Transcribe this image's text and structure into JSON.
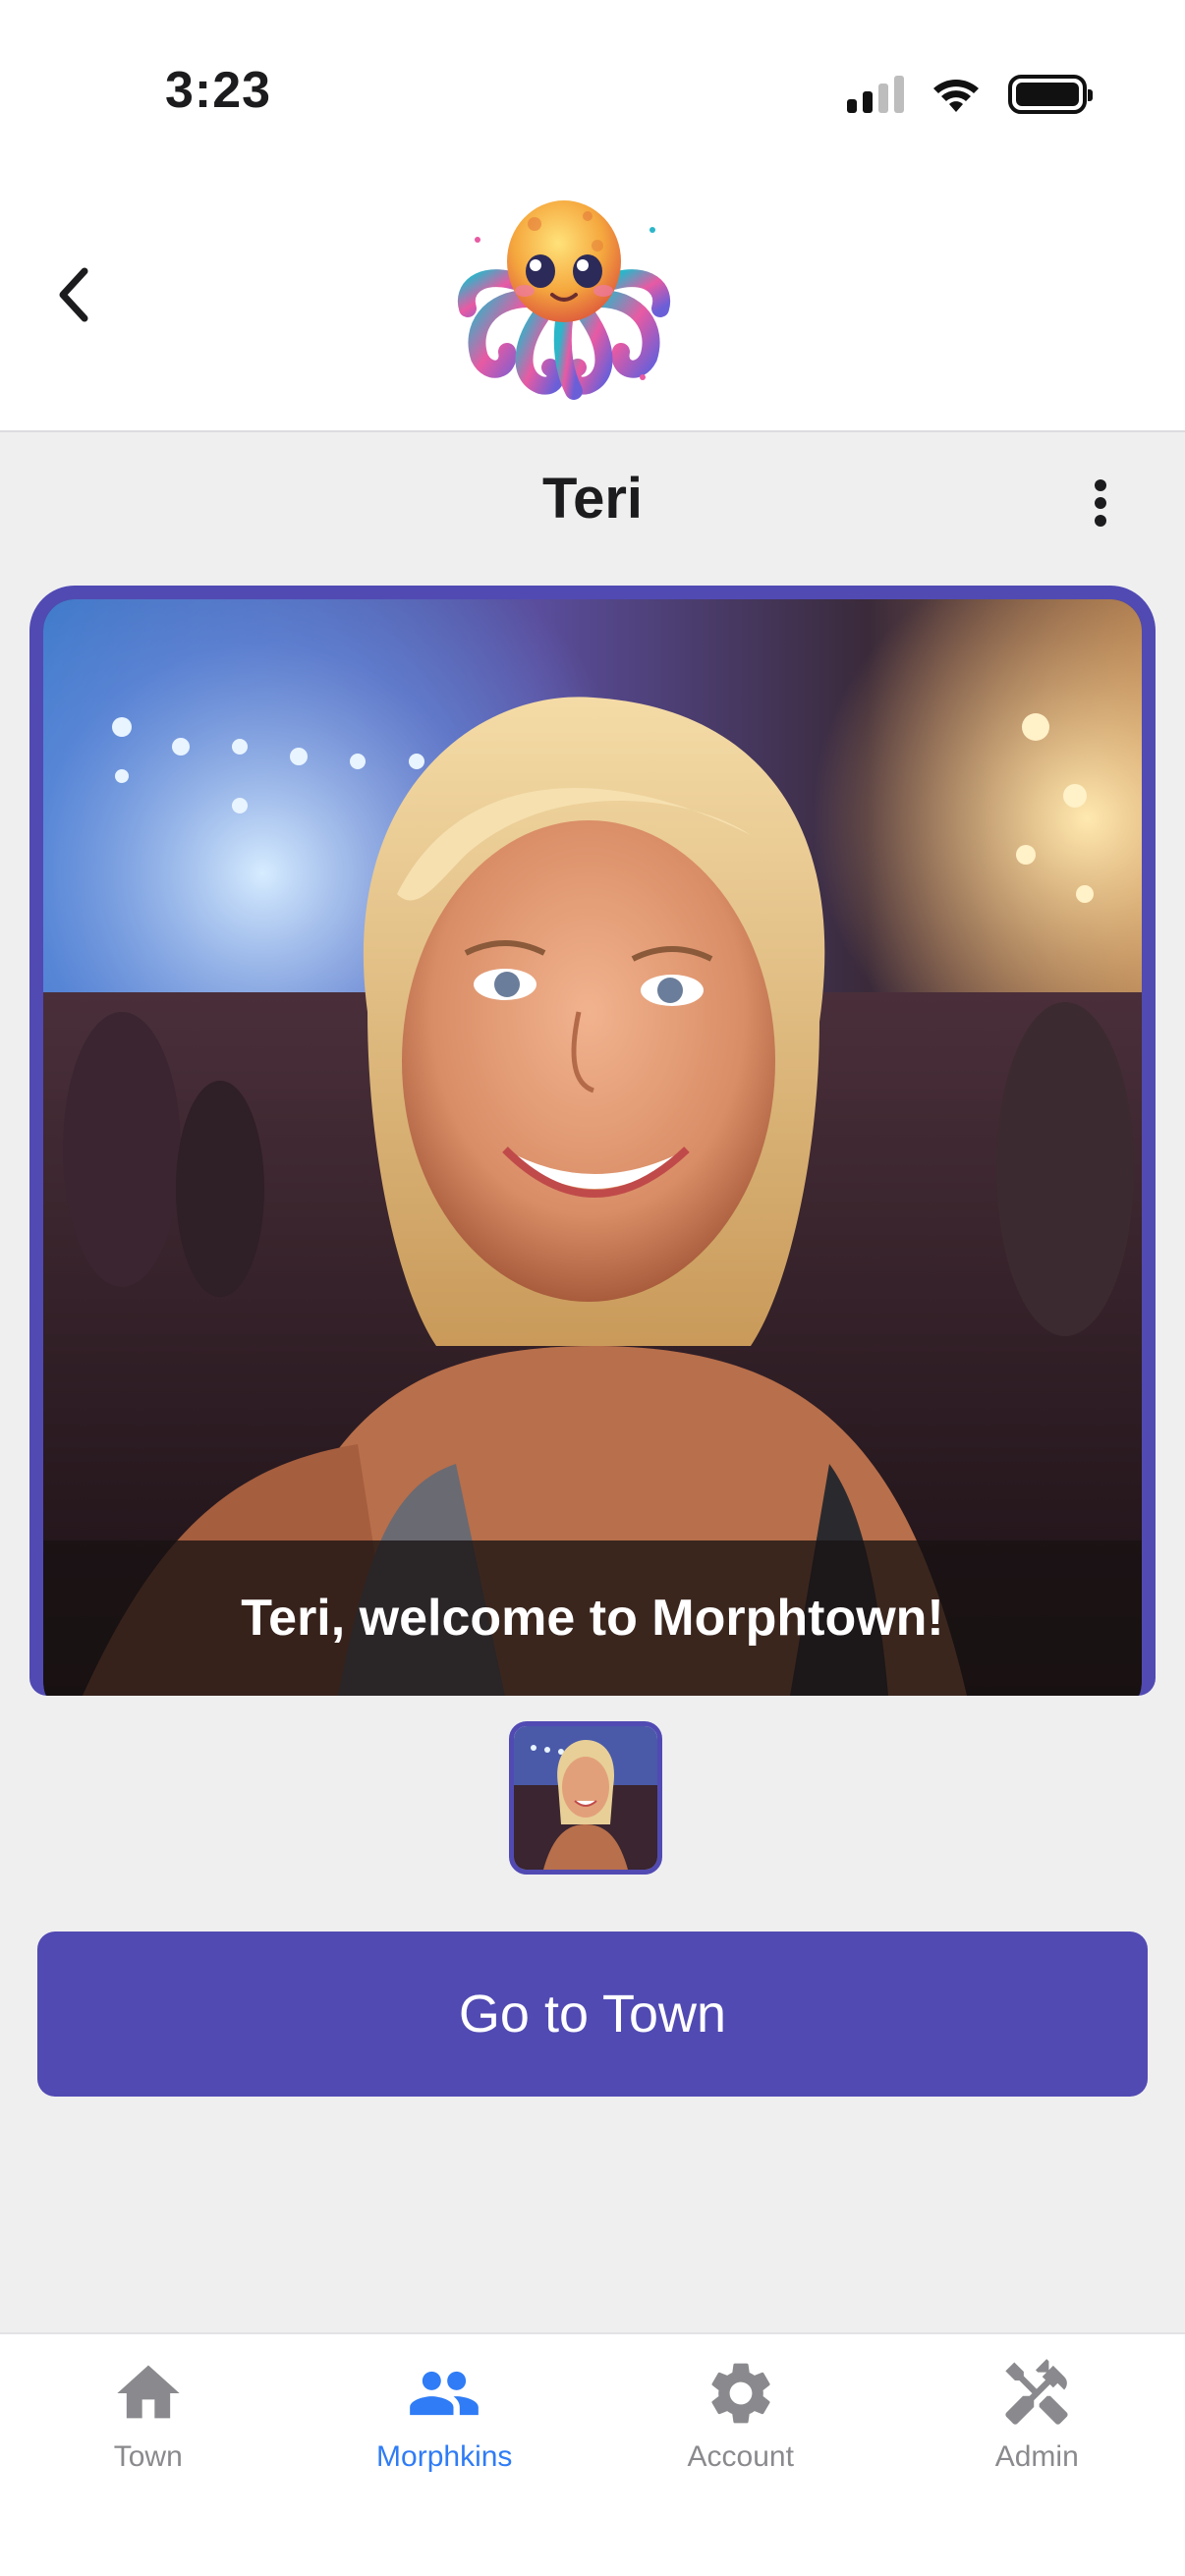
{
  "status_bar": {
    "time": "3:23"
  },
  "header": {
    "back_icon": "chevron-left-icon",
    "logo_icon": "octopus-mascot-icon"
  },
  "page": {
    "title": "Teri",
    "menu_icon": "vertical-dots-icon"
  },
  "photo": {
    "caption": "Teri, welcome to Morphtown!"
  },
  "cta": {
    "label": "Go to Town"
  },
  "tabs": [
    {
      "label": "Town",
      "icon": "home-icon",
      "active": false
    },
    {
      "label": "Morphkins",
      "icon": "people-icon",
      "active": true
    },
    {
      "label": "Account",
      "icon": "gear-icon",
      "active": false
    },
    {
      "label": "Admin",
      "icon": "tools-icon",
      "active": false
    }
  ],
  "colors": {
    "accent": "#514ab3",
    "tab_active": "#2f7cf6",
    "tab_inactive": "#8a8a8e",
    "background": "#efeff0"
  }
}
